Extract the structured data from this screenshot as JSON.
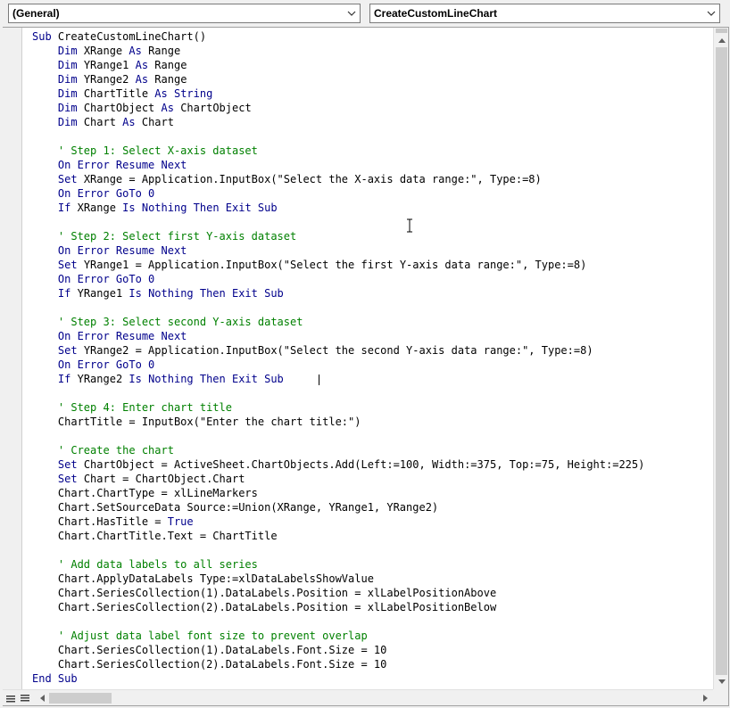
{
  "window": {
    "object_dropdown": {
      "value": "(General)"
    },
    "procedure_dropdown": {
      "value": "CreateCustomLineChart"
    }
  },
  "colors": {
    "keyword": "#00008b",
    "comment": "#008000",
    "text": "#000000",
    "background": "#ffffff"
  },
  "editor": {
    "lines": [
      [
        {
          "t": "Sub ",
          "c": "kw"
        },
        {
          "t": "CreateCustomLineChart()"
        }
      ],
      [
        {
          "t": "    "
        },
        {
          "t": "Dim ",
          "c": "kw"
        },
        {
          "t": "XRange "
        },
        {
          "t": "As ",
          "c": "kw"
        },
        {
          "t": "Range"
        }
      ],
      [
        {
          "t": "    "
        },
        {
          "t": "Dim ",
          "c": "kw"
        },
        {
          "t": "YRange1 "
        },
        {
          "t": "As ",
          "c": "kw"
        },
        {
          "t": "Range"
        }
      ],
      [
        {
          "t": "    "
        },
        {
          "t": "Dim ",
          "c": "kw"
        },
        {
          "t": "YRange2 "
        },
        {
          "t": "As ",
          "c": "kw"
        },
        {
          "t": "Range"
        }
      ],
      [
        {
          "t": "    "
        },
        {
          "t": "Dim ",
          "c": "kw"
        },
        {
          "t": "ChartTitle "
        },
        {
          "t": "As ",
          "c": "kw"
        },
        {
          "t": "String",
          "c": "kw"
        }
      ],
      [
        {
          "t": "    "
        },
        {
          "t": "Dim ",
          "c": "kw"
        },
        {
          "t": "ChartObject "
        },
        {
          "t": "As ",
          "c": "kw"
        },
        {
          "t": "ChartObject"
        }
      ],
      [
        {
          "t": "    "
        },
        {
          "t": "Dim ",
          "c": "kw"
        },
        {
          "t": "Chart "
        },
        {
          "t": "As ",
          "c": "kw"
        },
        {
          "t": "Chart"
        }
      ],
      [],
      [
        {
          "t": "    "
        },
        {
          "t": "' Step 1: Select X-axis dataset",
          "c": "cm"
        }
      ],
      [
        {
          "t": "    "
        },
        {
          "t": "On Error Resume Next",
          "c": "kw"
        }
      ],
      [
        {
          "t": "    "
        },
        {
          "t": "Set ",
          "c": "kw"
        },
        {
          "t": "XRange = Application.InputBox(\"Select the X-axis data range:\", Type:=8)"
        }
      ],
      [
        {
          "t": "    "
        },
        {
          "t": "On Error GoTo 0",
          "c": "kw"
        }
      ],
      [
        {
          "t": "    "
        },
        {
          "t": "If ",
          "c": "kw"
        },
        {
          "t": "XRange "
        },
        {
          "t": "Is Nothing Then Exit Sub",
          "c": "kw"
        }
      ],
      [],
      [
        {
          "t": "    "
        },
        {
          "t": "' Step 2: Select first Y-axis dataset",
          "c": "cm"
        }
      ],
      [
        {
          "t": "    "
        },
        {
          "t": "On Error Resume Next",
          "c": "kw"
        }
      ],
      [
        {
          "t": "    "
        },
        {
          "t": "Set ",
          "c": "kw"
        },
        {
          "t": "YRange1 = Application.InputBox(\"Select the first Y-axis data range:\", Type:=8)"
        }
      ],
      [
        {
          "t": "    "
        },
        {
          "t": "On Error GoTo 0",
          "c": "kw"
        }
      ],
      [
        {
          "t": "    "
        },
        {
          "t": "If ",
          "c": "kw"
        },
        {
          "t": "YRange1 "
        },
        {
          "t": "Is Nothing Then Exit Sub",
          "c": "kw"
        }
      ],
      [],
      [
        {
          "t": "    "
        },
        {
          "t": "' Step 3: Select second Y-axis dataset",
          "c": "cm"
        }
      ],
      [
        {
          "t": "    "
        },
        {
          "t": "On Error Resume Next",
          "c": "kw"
        }
      ],
      [
        {
          "t": "    "
        },
        {
          "t": "Set ",
          "c": "kw"
        },
        {
          "t": "YRange2 = Application.InputBox(\"Select the second Y-axis data range:\", Type:=8)"
        }
      ],
      [
        {
          "t": "    "
        },
        {
          "t": "On Error GoTo 0",
          "c": "kw"
        }
      ],
      [
        {
          "t": "    "
        },
        {
          "t": "If ",
          "c": "kw"
        },
        {
          "t": "YRange2 "
        },
        {
          "t": "Is Nothing Then Exit Sub",
          "c": "kw"
        }
      ],
      [],
      [
        {
          "t": "    "
        },
        {
          "t": "' Step 4: Enter chart title",
          "c": "cm"
        }
      ],
      [
        {
          "t": "    "
        },
        {
          "t": "ChartTitle = InputBox(\"Enter the chart title:\")"
        }
      ],
      [],
      [
        {
          "t": "    "
        },
        {
          "t": "' Create the chart",
          "c": "cm"
        }
      ],
      [
        {
          "t": "    "
        },
        {
          "t": "Set ",
          "c": "kw"
        },
        {
          "t": "ChartObject = ActiveSheet.ChartObjects.Add(Left:=100, Width:=375, Top:=75, Height:=225)"
        }
      ],
      [
        {
          "t": "    "
        },
        {
          "t": "Set ",
          "c": "kw"
        },
        {
          "t": "Chart = ChartObject.Chart"
        }
      ],
      [
        {
          "t": "    "
        },
        {
          "t": "Chart.ChartType = xlLineMarkers"
        }
      ],
      [
        {
          "t": "    "
        },
        {
          "t": "Chart.SetSourceData Source:=Union(XRange, YRange1, YRange2)"
        }
      ],
      [
        {
          "t": "    "
        },
        {
          "t": "Chart.HasTitle = "
        },
        {
          "t": "True",
          "c": "kw"
        }
      ],
      [
        {
          "t": "    "
        },
        {
          "t": "Chart.ChartTitle.Text = ChartTitle"
        }
      ],
      [],
      [
        {
          "t": "    "
        },
        {
          "t": "' Add data labels to all series",
          "c": "cm"
        }
      ],
      [
        {
          "t": "    "
        },
        {
          "t": "Chart.ApplyDataLabels Type:=xlDataLabelsShowValue"
        }
      ],
      [
        {
          "t": "    "
        },
        {
          "t": "Chart.SeriesCollection(1).DataLabels.Position = xlLabelPositionAbove"
        }
      ],
      [
        {
          "t": "    "
        },
        {
          "t": "Chart.SeriesCollection(2).DataLabels.Position = xlLabelPositionBelow"
        }
      ],
      [],
      [
        {
          "t": "    "
        },
        {
          "t": "' Adjust data label font size to prevent overlap",
          "c": "cm"
        }
      ],
      [
        {
          "t": "    "
        },
        {
          "t": "Chart.SeriesCollection(1).DataLabels.Font.Size = 10"
        }
      ],
      [
        {
          "t": "    "
        },
        {
          "t": "Chart.SeriesCollection(2).DataLabels.Font.Size = 10"
        }
      ],
      [
        {
          "t": "End Sub",
          "c": "kw"
        }
      ]
    ]
  },
  "icons": {
    "dropdown_arrow": "chevron-down-icon",
    "scroll_up": "triangle-up-icon",
    "scroll_down": "triangle-down-icon",
    "scroll_left": "triangle-left-icon",
    "scroll_right": "triangle-right-icon",
    "procedure_view": "procedure-view-icon",
    "full_module_view": "full-module-view-icon"
  }
}
